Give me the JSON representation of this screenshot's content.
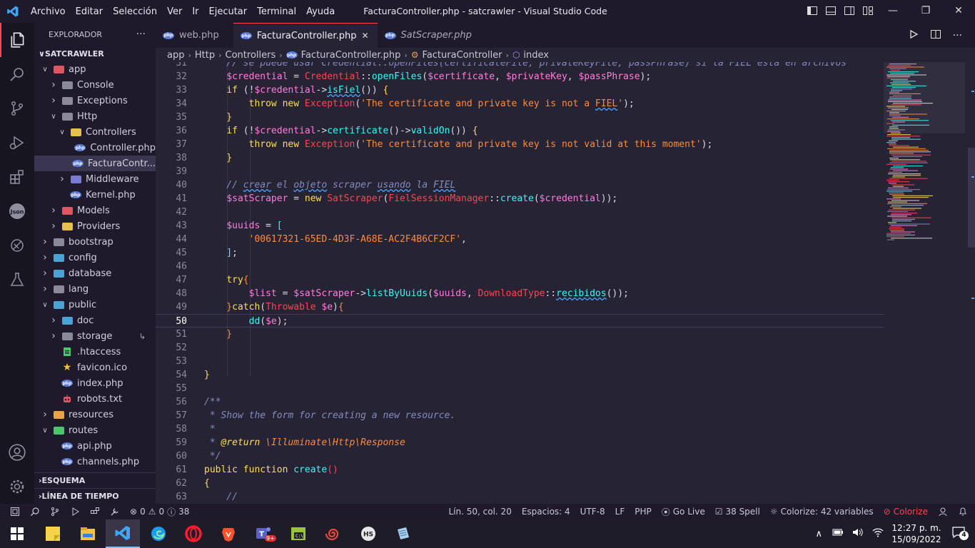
{
  "window": {
    "title": "FacturaController.php - satcrawler - Visual Studio Code",
    "menu": [
      "Archivo",
      "Editar",
      "Selección",
      "Ver",
      "Ir",
      "Ejecutar",
      "Terminal",
      "Ayuda"
    ]
  },
  "sidebar": {
    "title": "EXPLORADOR",
    "more": "···",
    "root": "SATCRAWLER",
    "tree": [
      {
        "label": "app",
        "kind": "folder",
        "open": true,
        "depth": 1,
        "color": "#e05561"
      },
      {
        "label": "Console",
        "kind": "folder",
        "open": false,
        "depth": 2,
        "color": "#8a8a9a"
      },
      {
        "label": "Exceptions",
        "kind": "folder",
        "open": false,
        "depth": 2,
        "color": "#8a8a9a"
      },
      {
        "label": "Http",
        "kind": "folder",
        "open": true,
        "depth": 2,
        "color": "#8a8a9a"
      },
      {
        "label": "Controllers",
        "kind": "folder",
        "open": true,
        "depth": 3,
        "color": "#e8c14a"
      },
      {
        "label": "Controller.php",
        "kind": "php",
        "depth": 4
      },
      {
        "label": "FacturaContr...",
        "kind": "php",
        "depth": 4,
        "selected": true
      },
      {
        "label": "Middleware",
        "kind": "folder",
        "open": false,
        "depth": 3,
        "color": "#7a7ad5"
      },
      {
        "label": "Kernel.php",
        "kind": "php",
        "depth": 3
      },
      {
        "label": "Models",
        "kind": "folder",
        "open": false,
        "depth": 2,
        "color": "#e05561"
      },
      {
        "label": "Providers",
        "kind": "folder",
        "open": false,
        "depth": 2,
        "color": "#e8c14a"
      },
      {
        "label": "bootstrap",
        "kind": "folder",
        "open": false,
        "depth": 1,
        "color": "#8a8a9a"
      },
      {
        "label": "config",
        "kind": "folder",
        "open": false,
        "depth": 1,
        "color": "#4aa3d5"
      },
      {
        "label": "database",
        "kind": "folder",
        "open": false,
        "depth": 1,
        "color": "#4aa3d5"
      },
      {
        "label": "lang",
        "kind": "folder",
        "open": false,
        "depth": 1,
        "color": "#8a8a9a"
      },
      {
        "label": "public",
        "kind": "folder",
        "open": true,
        "depth": 1,
        "color": "#4aa3d5"
      },
      {
        "label": "doc",
        "kind": "folder",
        "open": false,
        "depth": 2,
        "color": "#4aa3d5"
      },
      {
        "label": "storage",
        "kind": "folder",
        "open": false,
        "depth": 2,
        "color": "#8a8a9a"
      },
      {
        "label": ".htaccess",
        "kind": "file-green",
        "depth": 2
      },
      {
        "label": "favicon.ico",
        "kind": "file-star",
        "depth": 2
      },
      {
        "label": "index.php",
        "kind": "php",
        "depth": 2
      },
      {
        "label": "robots.txt",
        "kind": "file-robot",
        "depth": 2
      },
      {
        "label": "resources",
        "kind": "folder",
        "open": false,
        "depth": 1,
        "color": "#e8a34a"
      },
      {
        "label": "routes",
        "kind": "folder",
        "open": true,
        "depth": 1,
        "color": "#4ac76a"
      },
      {
        "label": "api.php",
        "kind": "php",
        "depth": 2
      },
      {
        "label": "channels.php",
        "kind": "php",
        "depth": 2
      }
    ],
    "sections": [
      "ESQUEMA",
      "LÍNEA DE TIEMPO"
    ]
  },
  "tabs": [
    {
      "label": "web.php",
      "active": false,
      "italic": false
    },
    {
      "label": "FacturaController.php",
      "active": true,
      "italic": false,
      "close": "✕"
    },
    {
      "label": "SatScraper.php",
      "active": false,
      "italic": true
    }
  ],
  "breadcrumb": [
    "app",
    "Http",
    "Controllers",
    "FacturaController.php",
    "FacturaController",
    "index"
  ],
  "statusbar": {
    "errors": "0",
    "warnings": "0",
    "info": "38",
    "position": "Lín. 50, col. 20",
    "spaces": "Espacios: 4",
    "encoding": "UTF-8",
    "eol": "LF",
    "language": "PHP",
    "golive": "Go Live",
    "spell": "38 Spell",
    "colorize_vars": "Colorize: 42 variables",
    "colorize": "Colorize"
  },
  "taskbar": {
    "time": "12:27 p. m.",
    "date": "15/09/2022",
    "notifications": "4",
    "teams_badge": "9+"
  },
  "code_lines": [
    {
      "n": "31",
      "tokens": [
        [
          "c-com",
          "    // se puede usar Credential::openFiles(certificateFile, privateKeyFile, passPhrase) si la FIEL está en archivos"
        ]
      ]
    },
    {
      "n": "32",
      "tokens": [
        [
          "c-pun",
          "    "
        ],
        [
          "c-var",
          "$credential"
        ],
        [
          "c-pun",
          " = "
        ],
        [
          "c-cls",
          "Credential"
        ],
        [
          "c-pun",
          "::"
        ],
        [
          "c-fn",
          "openFiles"
        ],
        [
          "c-pun",
          "("
        ],
        [
          "c-var",
          "$certificate"
        ],
        [
          "c-pun",
          ", "
        ],
        [
          "c-var",
          "$privateKey"
        ],
        [
          "c-pun",
          ", "
        ],
        [
          "c-var",
          "$passPhrase"
        ],
        [
          "c-pun",
          ");"
        ]
      ]
    },
    {
      "n": "33",
      "tokens": [
        [
          "c-pun",
          "    "
        ],
        [
          "c-kw",
          "if"
        ],
        [
          "c-pun",
          " (!"
        ],
        [
          "c-var",
          "$credential"
        ],
        [
          "c-pun",
          "->"
        ],
        [
          "c-fn squig",
          "isFiel"
        ],
        [
          "c-pun",
          "()) "
        ],
        [
          "c-kw",
          "{"
        ]
      ]
    },
    {
      "n": "34",
      "tokens": [
        [
          "c-pun",
          "        "
        ],
        [
          "c-kw",
          "throw new "
        ],
        [
          "c-cls",
          "Exception"
        ],
        [
          "c-pun",
          "("
        ],
        [
          "c-str",
          "'The certificate and private key is not a "
        ],
        [
          "c-str squig",
          "FIEL"
        ],
        [
          "c-str",
          "'"
        ],
        [
          "c-pun",
          ");"
        ]
      ]
    },
    {
      "n": "35",
      "tokens": [
        [
          "c-kw",
          "    }"
        ]
      ]
    },
    {
      "n": "36",
      "tokens": [
        [
          "c-pun",
          "    "
        ],
        [
          "c-kw",
          "if"
        ],
        [
          "c-pun",
          " (!"
        ],
        [
          "c-var",
          "$credential"
        ],
        [
          "c-pun",
          "->"
        ],
        [
          "c-fn",
          "certificate"
        ],
        [
          "c-pun",
          "()->"
        ],
        [
          "c-fn",
          "validOn"
        ],
        [
          "c-pun",
          "()) "
        ],
        [
          "c-kw",
          "{"
        ]
      ]
    },
    {
      "n": "37",
      "tokens": [
        [
          "c-pun",
          "        "
        ],
        [
          "c-kw",
          "throw new "
        ],
        [
          "c-cls",
          "Exception"
        ],
        [
          "c-pun",
          "("
        ],
        [
          "c-str",
          "'The certificate and private key is not valid at this moment'"
        ],
        [
          "c-pun",
          ");"
        ]
      ]
    },
    {
      "n": "38",
      "tokens": [
        [
          "c-kw",
          "    }"
        ]
      ]
    },
    {
      "n": "39",
      "tokens": []
    },
    {
      "n": "40",
      "tokens": [
        [
          "c-com",
          "    // "
        ],
        [
          "c-com squig",
          "crear"
        ],
        [
          "c-com",
          " el "
        ],
        [
          "c-com squig",
          "objeto"
        ],
        [
          "c-com",
          " scraper "
        ],
        [
          "c-com squig",
          "usando"
        ],
        [
          "c-com",
          " la "
        ],
        [
          "c-com squig",
          "FIEL"
        ]
      ]
    },
    {
      "n": "41",
      "tokens": [
        [
          "c-pun",
          "    "
        ],
        [
          "c-var",
          "$satScraper"
        ],
        [
          "c-pun",
          " = "
        ],
        [
          "c-kw",
          "new "
        ],
        [
          "c-cls",
          "SatScraper"
        ],
        [
          "c-pun",
          "("
        ],
        [
          "c-cls",
          "FielSessionManager"
        ],
        [
          "c-pun",
          "::"
        ],
        [
          "c-fn",
          "create"
        ],
        [
          "c-pun",
          "("
        ],
        [
          "c-var",
          "$credential"
        ],
        [
          "c-pun",
          "));"
        ]
      ]
    },
    {
      "n": "42",
      "tokens": []
    },
    {
      "n": "43",
      "tokens": [
        [
          "c-pun",
          "    "
        ],
        [
          "c-var",
          "$uuids"
        ],
        [
          "c-pun",
          " = "
        ],
        [
          "c-fn",
          "["
        ]
      ]
    },
    {
      "n": "44",
      "tokens": [
        [
          "c-pun",
          "        "
        ],
        [
          "c-str",
          "'00617321-65ED-4D3F-A68E-AC2F4B6CF2CF'"
        ],
        [
          "c-pun",
          ","
        ]
      ]
    },
    {
      "n": "45",
      "tokens": [
        [
          "c-fn",
          "    ]"
        ],
        [
          "c-pun",
          ";"
        ]
      ]
    },
    {
      "n": "46",
      "tokens": []
    },
    {
      "n": "47",
      "tokens": [
        [
          "c-pun",
          "    "
        ],
        [
          "c-kw",
          "try"
        ],
        [
          "c-str",
          "{"
        ]
      ]
    },
    {
      "n": "48",
      "tokens": [
        [
          "c-pun",
          "        "
        ],
        [
          "c-var",
          "$list"
        ],
        [
          "c-pun",
          " = "
        ],
        [
          "c-var",
          "$satScraper"
        ],
        [
          "c-pun",
          "->"
        ],
        [
          "c-fn",
          "listByUuids"
        ],
        [
          "c-pun",
          "("
        ],
        [
          "c-var",
          "$uuids"
        ],
        [
          "c-pun",
          ", "
        ],
        [
          "c-cls",
          "DownloadType"
        ],
        [
          "c-pun",
          "::"
        ],
        [
          "c-fn squig",
          "recibidos"
        ],
        [
          "c-pun",
          "());"
        ]
      ]
    },
    {
      "n": "49",
      "tokens": [
        [
          "c-str",
          "    }"
        ],
        [
          "c-kw",
          "catch"
        ],
        [
          "c-pun",
          "("
        ],
        [
          "c-cls",
          "Throwable"
        ],
        [
          "c-pun",
          " "
        ],
        [
          "c-var",
          "$e"
        ],
        [
          "c-pun",
          ")"
        ],
        [
          "c-str",
          "{"
        ]
      ]
    },
    {
      "n": "50",
      "tokens": [
        [
          "c-pun",
          "        "
        ],
        [
          "c-fn",
          "dd"
        ],
        [
          "c-pun",
          "("
        ],
        [
          "c-var",
          "$e"
        ],
        [
          "c-pun",
          ");"
        ]
      ],
      "current": true
    },
    {
      "n": "51",
      "tokens": [
        [
          "c-str",
          "    }"
        ]
      ]
    },
    {
      "n": "52",
      "tokens": []
    },
    {
      "n": "53",
      "tokens": []
    },
    {
      "n": "54",
      "tokens": [
        [
          "c-kw",
          "}"
        ]
      ]
    },
    {
      "n": "55",
      "tokens": []
    },
    {
      "n": "56",
      "tokens": [
        [
          "c-com",
          "/**"
        ]
      ]
    },
    {
      "n": "57",
      "tokens": [
        [
          "c-com",
          " * Show the form for creating a new resource."
        ]
      ]
    },
    {
      "n": "58",
      "tokens": [
        [
          "c-com",
          " *"
        ]
      ]
    },
    {
      "n": "59",
      "tokens": [
        [
          "c-com",
          " * "
        ],
        [
          "c-doc",
          "@return"
        ],
        [
          "c-com",
          " "
        ],
        [
          "c-dtype",
          "\\Illuminate\\Http\\Response"
        ]
      ]
    },
    {
      "n": "60",
      "tokens": [
        [
          "c-com",
          " */"
        ]
      ]
    },
    {
      "n": "61",
      "tokens": [
        [
          "c-kw",
          "public function "
        ],
        [
          "c-fn",
          "create"
        ],
        [
          "c-cls",
          "()"
        ]
      ]
    },
    {
      "n": "62",
      "tokens": [
        [
          "c-kw",
          "{"
        ]
      ]
    },
    {
      "n": "63",
      "tokens": [
        [
          "c-com",
          "    //"
        ]
      ]
    }
  ]
}
